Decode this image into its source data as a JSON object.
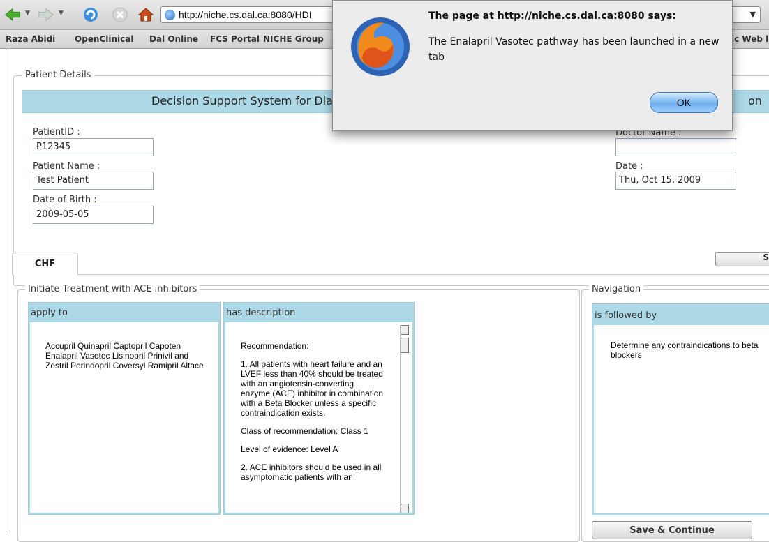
{
  "browser": {
    "url": "http://niche.cs.dal.ca:8080/HDI",
    "bookmarks": [
      "Raza Abidi",
      "OpenClinical",
      "Dal Online",
      "FCS Portal",
      "NICHE Group",
      "ic Web l"
    ]
  },
  "patient_details": {
    "legend": "Patient Details",
    "banner_visible_left": "Decision Support System for Dia",
    "banner_visible_right": "on",
    "patient_id_label": "PatientID :",
    "patient_id_value": "P12345",
    "patient_name_label": "Patient Name :",
    "patient_name_value": "Test Patient",
    "dob_label": "Date of Birth :",
    "dob_value": "2009-05-05",
    "doctor_name_label": "Doctor Name :",
    "doctor_name_value": "",
    "date_label": "Date :",
    "date_value": "Thu, Oct 15, 2009"
  },
  "tabs": {
    "active": "CHF",
    "right_button_fragment": "S"
  },
  "treatment": {
    "legend": "Initiate Treatment with ACE inhibitors",
    "apply_to_header": "apply to",
    "apply_to_text": "Accupril Quinapril Captopril Capoten Enalapril Vasotec Lisinopril Prinivil and Zestril Perindopril Coversyl Ramipril Altace",
    "description_header": "has description",
    "description_paragraphs": [
      "Recommendation:",
      "1. All patients with heart failure and an LVEF less than 40% should be treated with an angiotensin-converting enzyme (ACE) inhibitor in combination with a Beta Blocker unless a specific contraindication exists.",
      "Class of recommendation: Class 1",
      "Level of evidence: Level A",
      "2. ACE inhibitors should be used in all asymptomatic patients with an"
    ]
  },
  "navigation": {
    "legend": "Navigation",
    "followed_by_header": "is followed by",
    "followed_by_text": "Determine any contraindications to beta blockers",
    "save_button": "Save & Continue"
  },
  "alert": {
    "title": "The page at http://niche.cs.dal.ca:8080 says:",
    "message": "The Enalapril Vasotec pathway has been launched in a new tab",
    "ok_label": "OK"
  },
  "icons": {
    "back": "back-arrow-icon",
    "forward": "forward-arrow-icon",
    "reload": "reload-icon",
    "stop": "stop-icon",
    "home": "home-icon",
    "site": "globe-icon",
    "alert": "firefox-logo-icon"
  }
}
